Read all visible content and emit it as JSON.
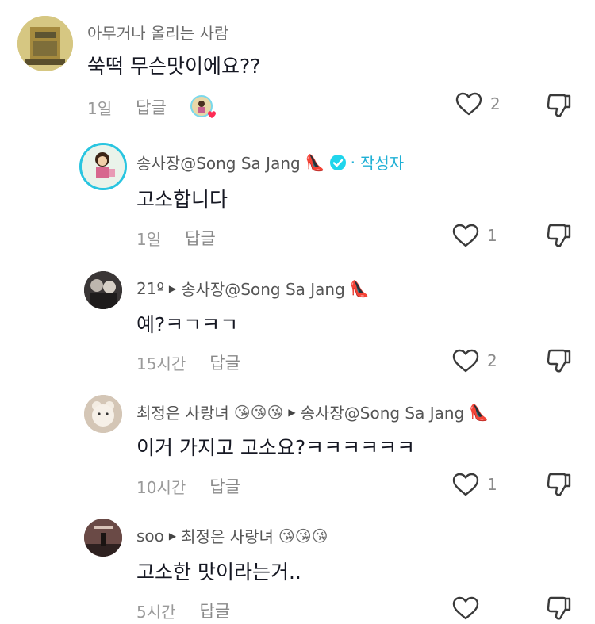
{
  "comments": [
    {
      "author": "아무거나 올리는 사람",
      "text": "쑥떡 무슨맛이에요??",
      "time": "1일",
      "reply_label": "답글",
      "likes": "2"
    },
    {
      "author": "송사장@Song Sa Jang",
      "creator_label": "작성자",
      "text": "고소합니다",
      "time": "1일",
      "reply_label": "답글",
      "likes": "1"
    },
    {
      "author": "21º",
      "reply_to": "송사장@Song Sa Jang",
      "text": "예?ㅋㄱㅋㄱ",
      "time": "15시간",
      "reply_label": "답글",
      "likes": "2"
    },
    {
      "author": "최정은 사랑녀",
      "reply_to": "송사장@Song Sa Jang",
      "text": "이거 가지고 고소요?ㅋㅋㅋㅋㅋㅋ",
      "time": "10시간",
      "reply_label": "답글",
      "likes": "1"
    },
    {
      "author": "soo",
      "reply_to": "최정은 사랑녀",
      "text": "고소한 맛이라는거..",
      "time": "5시간",
      "reply_label": "답글",
      "likes": ""
    }
  ],
  "colors": {
    "creator_accent": "#20b0d5",
    "liked_heart": "#fe2c55",
    "text": "#161823",
    "muted": "#8a8a8a"
  },
  "icons": {
    "like": "heart-outline-icon",
    "dislike": "thumbs-down-outline-icon",
    "verified": "verified-check-icon",
    "reply_arrow": "reply-triangle-icon",
    "heels": "high-heel-emoji",
    "kiss": "kissing-face-emoji"
  }
}
